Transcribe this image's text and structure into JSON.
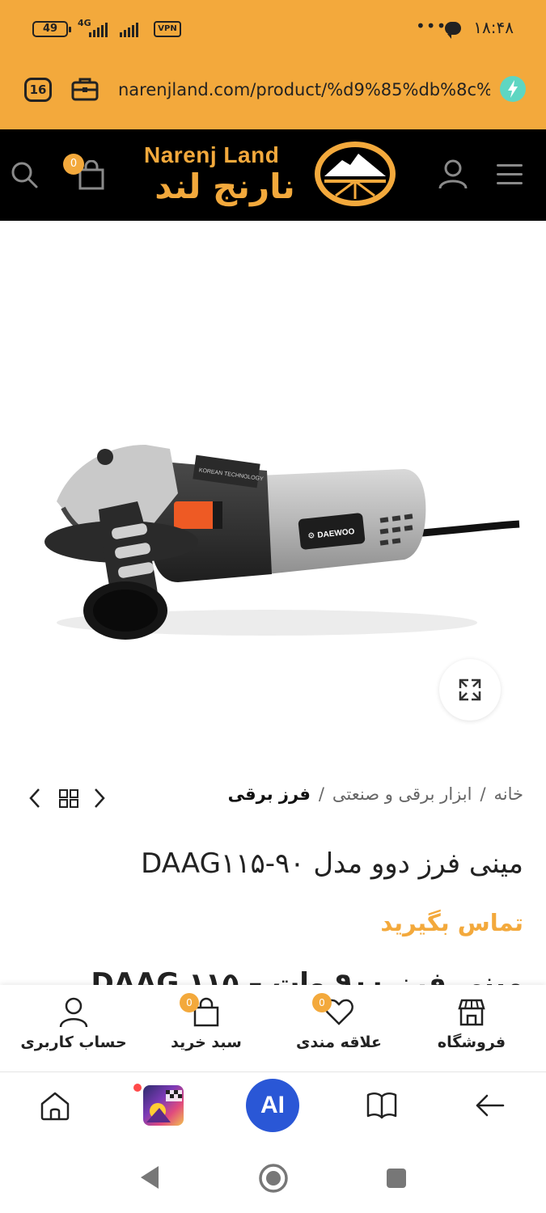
{
  "status_bar": {
    "time": "۱۸:۴۸",
    "battery": "49",
    "network": "4G",
    "vpn": "VPN",
    "more": "•••"
  },
  "browser": {
    "tab_count": "16",
    "url": "narenjland.com/product/%d9%85%db%8c%"
  },
  "site": {
    "logo_en": "Narenj Land",
    "logo_fa": "نارنج لند",
    "cart_count": "0"
  },
  "product_image": {
    "brand_on_tool": "DAEWOO",
    "label_on_tool": "KOREAN TECHNOLOGY"
  },
  "breadcrumb": {
    "items": [
      "خانه",
      "ابزار برقی و صنعتی",
      "فرز برقی"
    ],
    "separator": "/"
  },
  "product": {
    "title": "مینی فرز دوو مدل DAAG۱۱۵-۹۰",
    "price_text": "تماس بگیرید",
    "description_heading": "مینی فرز ۹۰۰ وات – DAAG ۱۱۵"
  },
  "site_bottom_bar": {
    "items": [
      {
        "label": "فروشگاه"
      },
      {
        "label": "علاقه مندی",
        "badge": "0"
      },
      {
        "label": "سبد خرید",
        "badge": "0"
      },
      {
        "label": "حساب کاربری"
      }
    ]
  },
  "browser_toolbar": {
    "ai_label": "AI"
  },
  "colors": {
    "accent": "#f3a93c",
    "header_bg": "#000000",
    "ai_blue": "#2a57d6"
  }
}
